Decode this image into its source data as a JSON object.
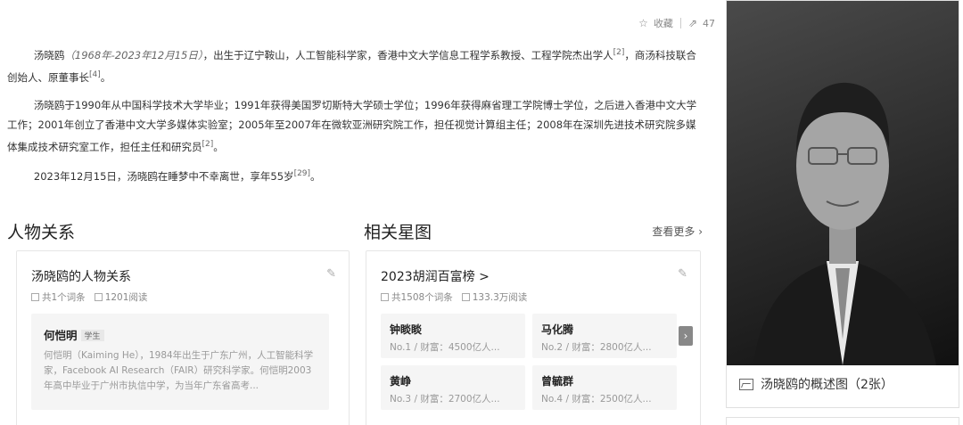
{
  "toolbar": {
    "favorite_label": "收藏",
    "share_count": "47"
  },
  "intro": {
    "p1_name": "汤晓鸥",
    "p1_dates": "（1968年-2023年12月15日）",
    "p1_text": "，出生于辽宁鞍山，人工智能科学家，香港中文大学信息工程学系教授、工程学院杰出学人",
    "p1_ref1": "[2]",
    "p1_text2": "，商汤科技联合创始人、原董事长",
    "p1_ref2": "[4]",
    "p1_end": "。",
    "p2_text": "汤晓鸥于1990年从中国科学技术大学毕业；1991年获得美国罗切斯特大学硕士学位；1996年获得麻省理工学院博士学位，之后进入香港中文大学工作；2001年创立了香港中文大学多媒体实验室；2005年至2007年在微软亚洲研究院工作，担任视觉计算组主任；2008年在深圳先进技术研究院多媒体集成技术研究室工作，担任主任和研究员",
    "p2_ref": "[2]",
    "p2_end": "。",
    "p3_text": "2023年12月15日，汤晓鸥在睡梦中不幸离世，享年55岁",
    "p3_ref": "[29]",
    "p3_end": "。"
  },
  "relations": {
    "section_title": "人物关系",
    "card_title": "汤晓鸥的人物关系",
    "meta_entries": "共1个词条",
    "meta_reads": "1201阅读",
    "person": {
      "name": "何恺明",
      "tag": "学生",
      "desc": "何恺明（Kaiming He），1984年出生于广东广州，人工智能科学家，Facebook AI Research（FAIR）研究科学家。何恺明2003年高中毕业于广州市执信中学，为当年广东省高考..."
    }
  },
  "stars": {
    "section_title": "相关星图",
    "more_label": "查看更多",
    "card_title": "2023胡润百富榜 >",
    "meta_entries": "共1508个词条",
    "meta_reads": "133.3万阅读",
    "items": [
      {
        "name": "钟睒睒",
        "sub": "No.1 / 财富：4500亿人..."
      },
      {
        "name": "马化腾",
        "sub": "No.2 / 财富：2800亿人..."
      },
      {
        "name": "黄峥",
        "sub": "No.3 / 财富：2700亿人..."
      },
      {
        "name": "曾毓群",
        "sub": "No.4 / 财富：2500亿人..."
      }
    ]
  },
  "photo": {
    "caption": "汤晓鸥的概述图（2张）"
  }
}
